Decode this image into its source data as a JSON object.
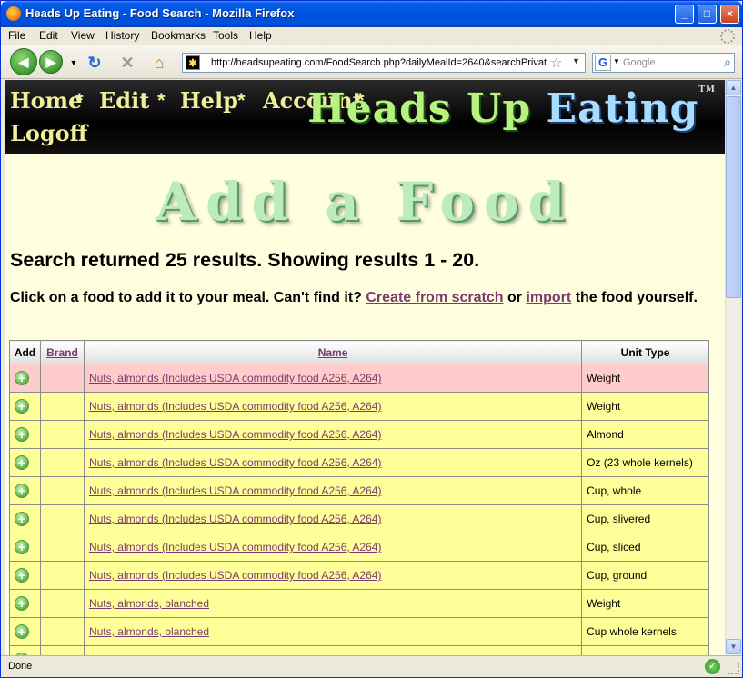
{
  "window": {
    "title": "Heads Up Eating - Food Search - Mozilla Firefox",
    "controls": [
      "_",
      "□",
      "×"
    ]
  },
  "menu": [
    "File",
    "Edit",
    "View",
    "History",
    "Bookmarks",
    "Tools",
    "Help"
  ],
  "toolbar": {
    "url": "http://headsupeating.com/FoodSearch.php?dailyMealId=2640&searchPrivat",
    "search_placeholder": "Google",
    "search_engine": "G"
  },
  "site": {
    "nav": [
      "Home",
      "Edit",
      "Help",
      "Account",
      "Logoff"
    ],
    "separator": "*",
    "brand_part1": "Heads Up",
    "brand_part2": "Eating",
    "brand_tm": "TM"
  },
  "page": {
    "heading": "Add a Food",
    "summary": "Search returned 25 results. Showing results 1 - 20.",
    "instr_prefix": "Click on a food to add it to your meal. Can't find it?",
    "create_link": "Create from scratch",
    "instr_or": "or",
    "import_link": "import",
    "instr_suffix": "the food yourself."
  },
  "table": {
    "headers": {
      "add": "Add",
      "brand": "Brand",
      "name": "Name",
      "unit": "Unit Type"
    },
    "rows": [
      {
        "brand": "",
        "name": "Nuts, almonds (Includes USDA commodity food A256, A264)",
        "unit": "Weight",
        "highlight": true
      },
      {
        "brand": "",
        "name": "Nuts, almonds (Includes USDA commodity food A256, A264)",
        "unit": "Weight"
      },
      {
        "brand": "",
        "name": "Nuts, almonds (Includes USDA commodity food A256, A264)",
        "unit": "Almond"
      },
      {
        "brand": "",
        "name": "Nuts, almonds (Includes USDA commodity food A256, A264)",
        "unit": "Oz (23 whole kernels)"
      },
      {
        "brand": "",
        "name": "Nuts, almonds (Includes USDA commodity food A256, A264)",
        "unit": "Cup, whole"
      },
      {
        "brand": "",
        "name": "Nuts, almonds (Includes USDA commodity food A256, A264)",
        "unit": "Cup, slivered"
      },
      {
        "brand": "",
        "name": "Nuts, almonds (Includes USDA commodity food A256, A264)",
        "unit": "Cup, sliced"
      },
      {
        "brand": "",
        "name": "Nuts, almonds (Includes USDA commodity food A256, A264)",
        "unit": "Cup, ground"
      },
      {
        "brand": "",
        "name": "Nuts, almonds, blanched",
        "unit": "Weight"
      },
      {
        "brand": "",
        "name": "Nuts, almonds, blanched",
        "unit": "Cup whole kernels"
      },
      {
        "brand": "",
        "name": "",
        "unit": ""
      }
    ]
  },
  "status": {
    "text": "Done"
  }
}
